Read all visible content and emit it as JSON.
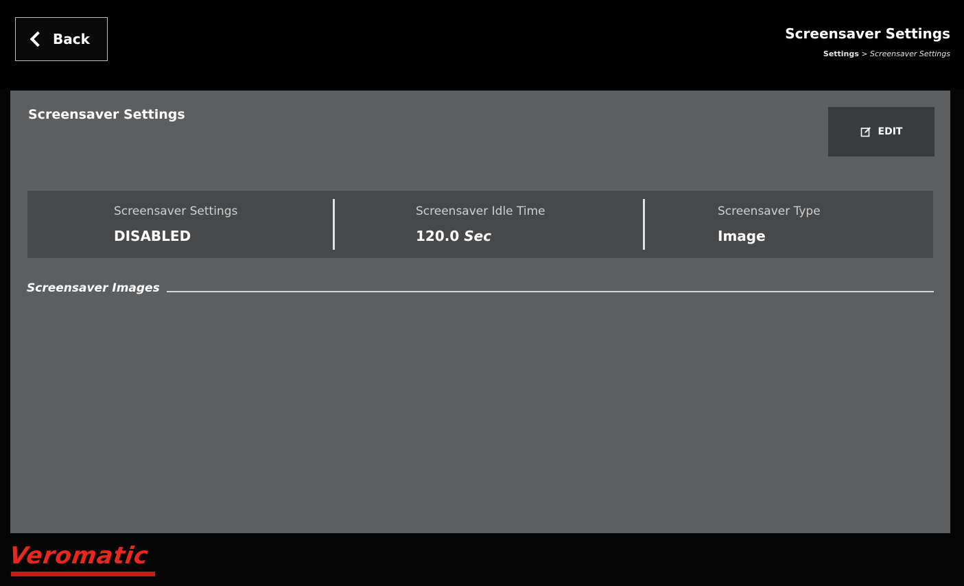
{
  "header": {
    "back_label": "Back",
    "title": "Screensaver Settings",
    "breadcrumb": {
      "parent": "Settings",
      "separator": ">",
      "current": "Screensaver Settings"
    }
  },
  "panel": {
    "title": "Screensaver Settings",
    "edit_label": "EDIT",
    "info": [
      {
        "label": "Screensaver Settings",
        "value": "DISABLED",
        "unit": ""
      },
      {
        "label": "Screensaver Idle Time",
        "value": "120.0",
        "unit": "Sec"
      },
      {
        "label": "Screensaver Type",
        "value": "Image",
        "unit": ""
      }
    ],
    "images_section_title": "Screensaver Images"
  },
  "brand": {
    "name": "Veromatic",
    "color": "#e8281e"
  },
  "icons": {
    "back": "chevron-left-icon",
    "edit": "edit-icon"
  }
}
